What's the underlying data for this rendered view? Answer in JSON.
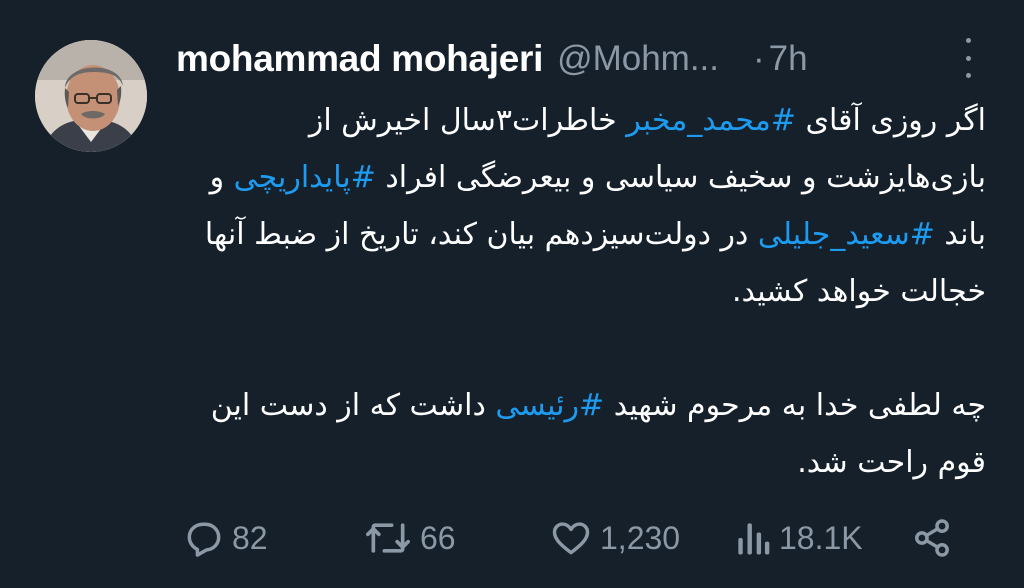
{
  "tweet": {
    "author": {
      "display_name": "mohammad mohajeri",
      "handle": "@Mohm...",
      "avatar_icon": "avatar-photo"
    },
    "separator": "·",
    "time": "7h",
    "text": {
      "p1": [
        {
          "t": "اگر روزی آقای ",
          "tag": false
        },
        {
          "t": "#محمد_مخبر",
          "tag": true
        },
        {
          "t": " خاطرات۳سال اخیرش از بازی‌هایزشت و سخیف سیاسی و بیعرضگی افراد ",
          "tag": false
        },
        {
          "t": "#پایداریچی",
          "tag": true
        },
        {
          "t": " و باند ",
          "tag": false
        },
        {
          "t": "#سعید_جلیلی",
          "tag": true
        },
        {
          "t": " در دولت‌سیزدهم بیان کند، تاریخ از ضبط آنها خجالت خواهد کشید.",
          "tag": false
        }
      ],
      "p2": [
        {
          "t": "چه لطفی خدا به مرحوم شهید ",
          "tag": false
        },
        {
          "t": "#رئیسی",
          "tag": true
        },
        {
          "t": " داشت که از دست این قوم راحت شد.",
          "tag": false
        }
      ]
    },
    "actions": {
      "replies": "82",
      "retweets": "66",
      "likes": "1,230",
      "views": "18.1K"
    },
    "colors": {
      "background": "#15202b",
      "text": "#ffffff",
      "secondary": "#8b98a5",
      "accent": "#1d9bf0"
    }
  }
}
